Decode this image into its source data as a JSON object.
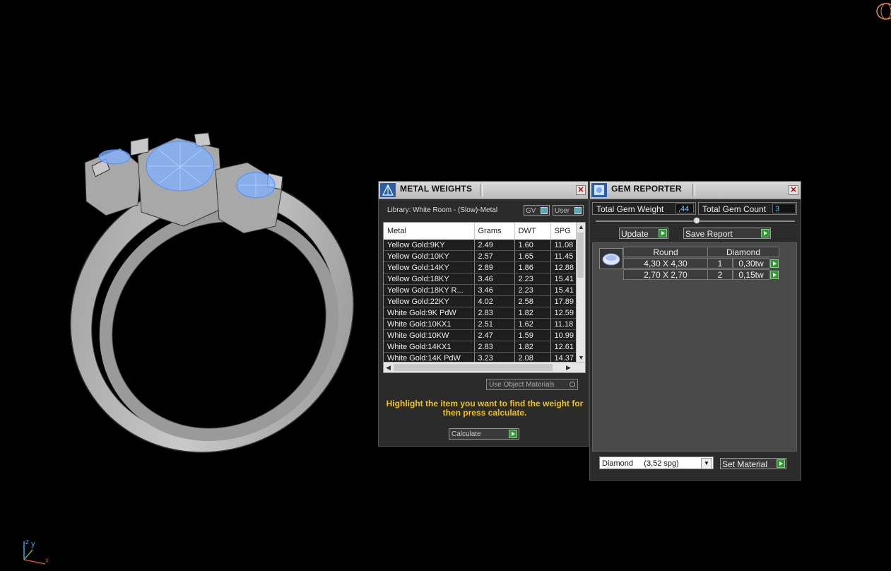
{
  "metal_weights": {
    "title": "METAL WEIGHTS",
    "library_label": "Library: White Room - (Slow)-Metal",
    "gv_label": "GV",
    "user_label": "User",
    "columns": [
      "Metal",
      "Grams",
      "DWT",
      "SPG"
    ],
    "rows": [
      [
        "Yellow Gold:9KY",
        "2.49",
        "1.60",
        "11.08"
      ],
      [
        "Yellow Gold:10KY",
        "2.57",
        "1.65",
        "11.45"
      ],
      [
        "Yellow Gold:14KY",
        "2.89",
        "1.86",
        "12.88"
      ],
      [
        "Yellow Gold:18KY",
        "3.46",
        "2.23",
        "15.41"
      ],
      [
        "Yellow Gold:18KY R...",
        "3.46",
        "2.23",
        "15.41"
      ],
      [
        "Yellow Gold:22KY",
        "4.02",
        "2.58",
        "17.89"
      ],
      [
        "White Gold:9K PdW",
        "2.83",
        "1.82",
        "12.59"
      ],
      [
        "White Gold:10KX1",
        "2.51",
        "1.62",
        "11.18"
      ],
      [
        "White Gold:10KW",
        "2.47",
        "1.59",
        "10.99"
      ],
      [
        "White Gold:14KX1",
        "2.83",
        "1.82",
        "12.61"
      ],
      [
        "White Gold:14K PdW",
        "3.23",
        "2.08",
        "14.37"
      ]
    ],
    "use_object_materials": "Use Object Materials",
    "hint": "Highlight the item you want to find the weight for then press calculate.",
    "calculate_label": "Calculate"
  },
  "gem_reporter": {
    "title": "GEM REPORTER",
    "total_weight_label": "Total Gem Weight",
    "total_weight_value": ",44",
    "total_count_label": "Total Gem Count",
    "total_count_value": "3",
    "update_label": "Update",
    "save_report_label": "Save Report",
    "header_shape": "Round",
    "header_material": "Diamond",
    "gems": [
      {
        "size": "4,30 X 4,30",
        "count": "1",
        "weight": "0,30tw"
      },
      {
        "size": "2,70 X 2,70",
        "count": "2",
        "weight": "0,15tw"
      }
    ],
    "material_select": "Diamond     (3,52 spg)",
    "set_material_label": "Set Material"
  },
  "viewport": {
    "axis_y": "y",
    "axis_x": "x",
    "axis_z": "z"
  },
  "colors": {
    "hint": "#f0c020",
    "gem_highlight": "#6aa8ff",
    "go_button": "#2e9a2e",
    "value_text": "#66ccff"
  }
}
